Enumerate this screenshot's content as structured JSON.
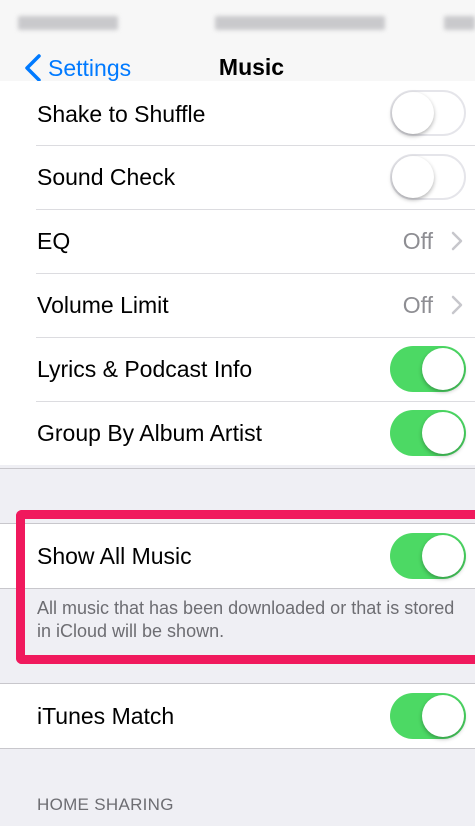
{
  "nav": {
    "back_label": "Settings",
    "title": "Music"
  },
  "settings": {
    "shake_to_shuffle": {
      "label": "Shake to Shuffle",
      "on": false
    },
    "sound_check": {
      "label": "Sound Check",
      "on": false
    },
    "eq": {
      "label": "EQ",
      "value": "Off"
    },
    "volume_limit": {
      "label": "Volume Limit",
      "value": "Off"
    },
    "lyrics_podcast_info": {
      "label": "Lyrics & Podcast Info",
      "on": true
    },
    "group_by_album_artist": {
      "label": "Group By Album Artist",
      "on": true
    },
    "show_all_music": {
      "label": "Show All Music",
      "on": true,
      "footer": "All music that has been downloaded or that is stored in iCloud will be shown."
    },
    "itunes_match": {
      "label": "iTunes Match",
      "on": true
    }
  },
  "sections": {
    "home_sharing_header": "HOME SHARING"
  },
  "colors": {
    "accent": "#007aff",
    "toggle_on": "#4cd964",
    "highlight": "#f0195d",
    "background": "#efeff4"
  }
}
